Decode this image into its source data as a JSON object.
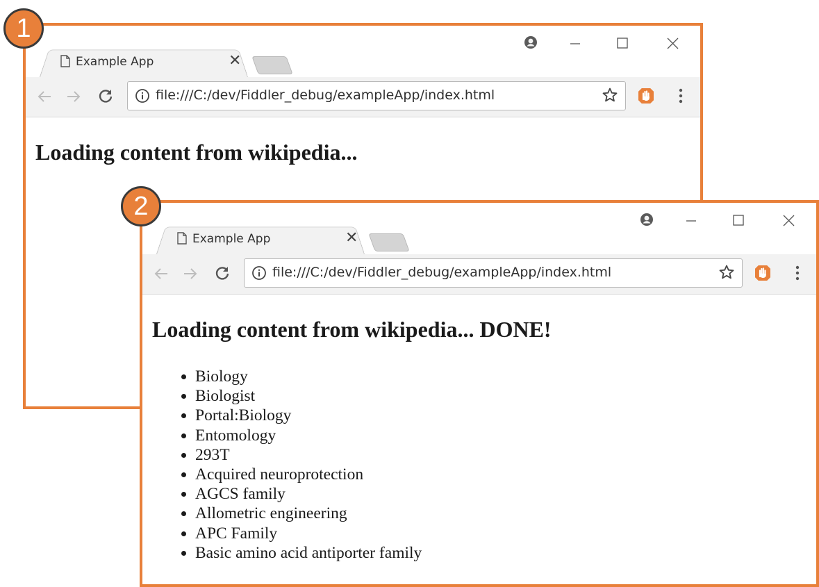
{
  "colors": {
    "accent": "#e8803a",
    "badge_outline": "#3a3a3a",
    "toolbar_bg": "#f2f2f2",
    "extension_icon": "#e8803a"
  },
  "badges": {
    "first": "1",
    "second": "2"
  },
  "window1": {
    "tab": {
      "title": "Example App",
      "close_glyph": "✕"
    },
    "address_bar": {
      "url": "file:///C:/dev/Fiddler_debug/exampleApp/index.html"
    },
    "page": {
      "heading": "Loading content from wikipedia..."
    },
    "icons": [
      "page-icon",
      "profile-icon",
      "minimize-icon",
      "maximize-icon",
      "close-window-icon",
      "back-arrow-icon",
      "forward-arrow-icon",
      "reload-icon",
      "info-icon",
      "bookmark-star-icon",
      "extension-hand-icon",
      "menu-dots-icon"
    ]
  },
  "window2": {
    "tab": {
      "title": "Example App",
      "close_glyph": "✕"
    },
    "address_bar": {
      "url": "file:///C:/dev/Fiddler_debug/exampleApp/index.html"
    },
    "page": {
      "heading": "Loading content from wikipedia... DONE!",
      "items": [
        "Biology",
        "Biologist",
        "Portal:Biology",
        "Entomology",
        "293T",
        "Acquired neuroprotection",
        "AGCS family",
        "Allometric engineering",
        "APC Family",
        "Basic amino acid antiporter family"
      ]
    }
  }
}
